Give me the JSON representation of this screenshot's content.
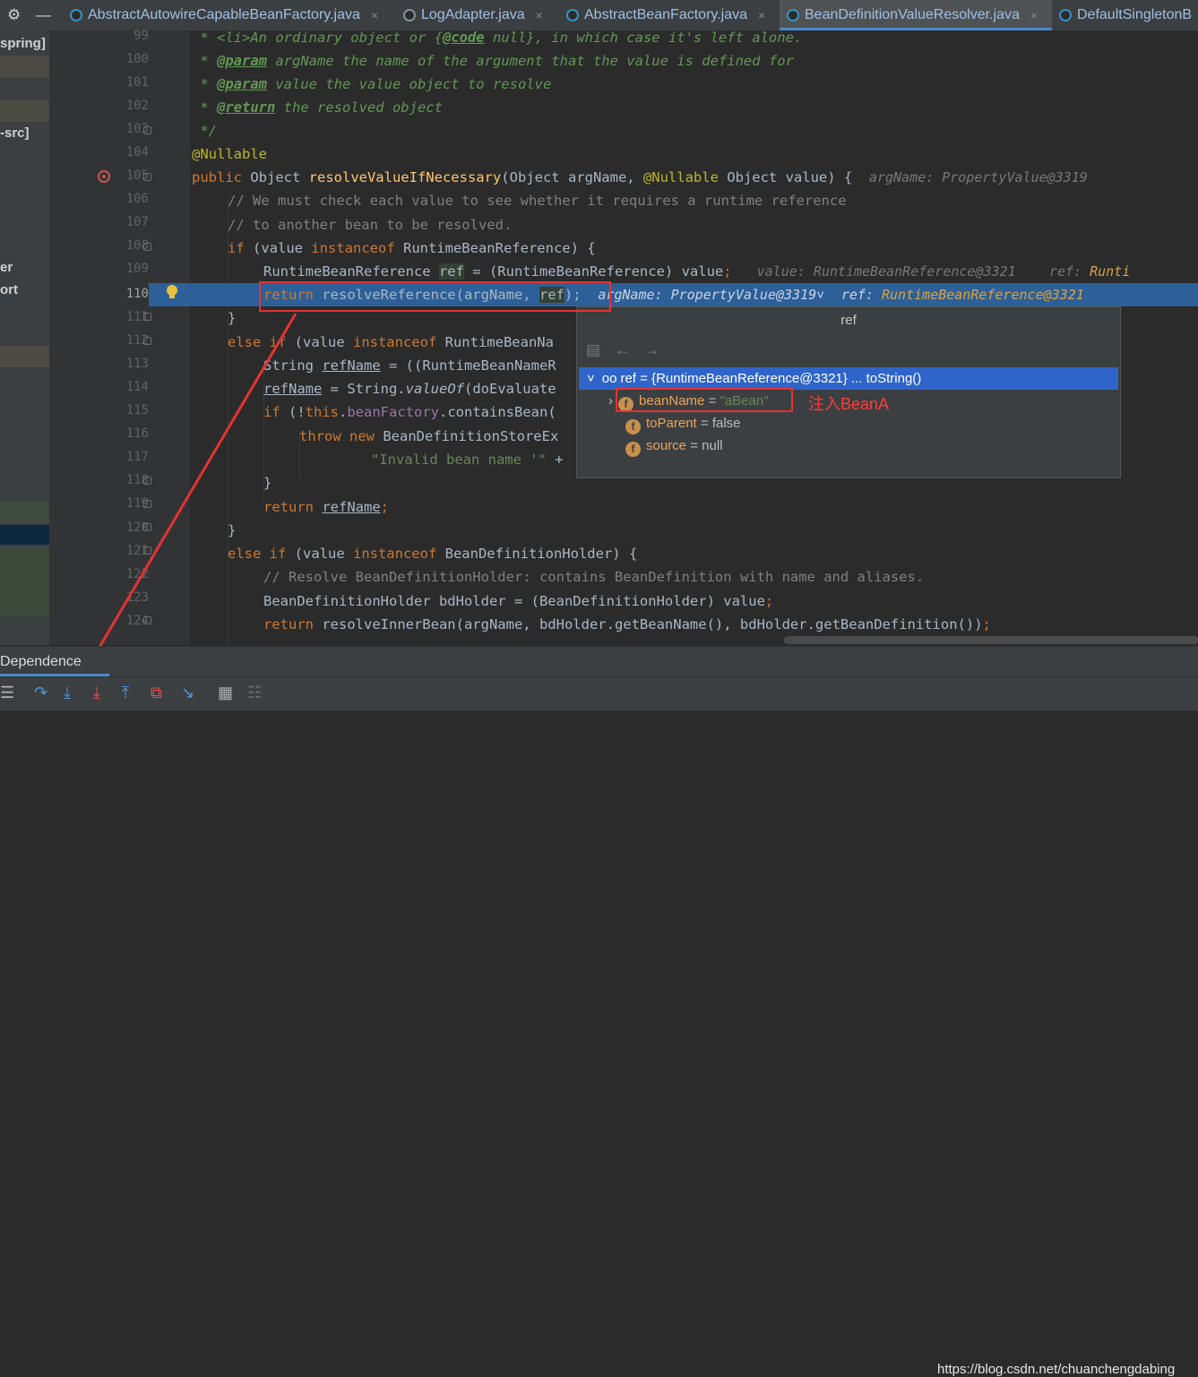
{
  "tabs": [
    {
      "label": "AbstractAutowireCapableBeanFactory.java",
      "close": "×",
      "active": false
    },
    {
      "label": "LogAdapter.java",
      "close": "×",
      "active": false
    },
    {
      "label": "AbstractBeanFactory.java",
      "close": "×",
      "active": false
    },
    {
      "label": "BeanDefinitionValueResolver.java",
      "close": "×",
      "active": true
    },
    {
      "label": "DefaultSingletonB",
      "close": "",
      "active": false
    }
  ],
  "project": {
    "labels": [
      "spring]",
      "-src]",
      "er",
      "ort"
    ]
  },
  "line_numbers": [
    "99",
    "100",
    "101",
    "102",
    "103",
    "104",
    "105",
    "106",
    "107",
    "108",
    "109",
    "110",
    "111",
    "112",
    "113",
    "114",
    "115",
    "116",
    "117",
    "118",
    "119",
    "120",
    "121",
    "122",
    "123",
    "124"
  ],
  "code": {
    "l99_a": " * <li>An ordinary object or {",
    "l99_b": "@code",
    "l99_c": " null}, in which case it's left alone.",
    "l100_a": " * ",
    "l100_tag": "@param",
    "l100_b": " argName the name of the argument that the value is defined for",
    "l101_a": " * ",
    "l101_tag": "@param",
    "l101_b": " value the value object to resolve",
    "l102_a": " * ",
    "l102_tag": "@return",
    "l102_b": " the resolved object",
    "l103": " */",
    "l104": "@Nullable",
    "l105_kw": "public ",
    "l105_a": "Object ",
    "l105_fn": "resolveValueIfNecessary",
    "l105_b": "(Object argName, ",
    "l105_ann": "@Nullable",
    "l105_c": " Object value) {",
    "l105_hint": "argName: PropertyValue@3319",
    "l106": "// We must check each value to see whether it requires a runtime reference",
    "l107": "// to another bean to be resolved.",
    "l108_kw1": "if ",
    "l108_a": "(value ",
    "l108_kw2": "instanceof ",
    "l108_b": "RuntimeBeanReference) {",
    "l109_a": "RuntimeBeanReference ",
    "l109_ref": "ref",
    "l109_b": " = (RuntimeBeanReference) value",
    "l109_semi": ";",
    "l109_hint1": "value: RuntimeBeanReference@3321",
    "l109_hint2": "ref: ",
    "l109_hint3": "Runti",
    "l110_kw": "return ",
    "l110_a": "resolveReference(argName, ",
    "l110_ref": "ref",
    "l110_b": ");",
    "l110_hint1": "argName: PropertyValue@3319",
    "l110_chev": "˅",
    "l110_hint2": "ref: ",
    "l110_hint3": "RuntimeBeanReference@3321",
    "l111": "}",
    "l112_kw1": "else if ",
    "l112_a": "(value ",
    "l112_kw2": "instanceof ",
    "l112_b": "RuntimeBeanNa",
    "l113_a": "String ",
    "l113_ul": "refName",
    "l113_b": " = ((RuntimeBeanNameR",
    "l114_ul": "refName",
    "l114_a": " = String.",
    "l114_it": "valueOf",
    "l114_b": "(doEvaluate",
    "l115_kw": "if ",
    "l115_a": "(!",
    "l115_kw2": "this",
    "l115_b": ".",
    "l115_fld": "beanFactory",
    "l115_c": ".containsBean(",
    "l116_kw": "throw new ",
    "l116_a": "BeanDefinitionStoreEx",
    "l117_str": "\"Invalid bean name '\"",
    "l117_a": " +",
    "l118": "}",
    "l119_kw": "return ",
    "l119_ul": "refName",
    "l119_semi": ";",
    "l120": "}",
    "l121_kw1": "else if ",
    "l121_a": "(value ",
    "l121_kw2": "instanceof ",
    "l121_b": "BeanDefinitionHolder) {",
    "l122": "// Resolve BeanDefinitionHolder: contains BeanDefinition with name and aliases.",
    "l123_a": "BeanDefinitionHolder bdHolder = (BeanDefinitionHolder) value",
    "l123_semi": ";",
    "l124_kw": "return ",
    "l124_a": "resolveInnerBean(argName, bdHolder.getBeanName(), bdHolder.getBeanDefinition())",
    "l124_semi": ";"
  },
  "popup": {
    "title": "ref",
    "root": {
      "chevron": "˅",
      "glasses": "oo",
      "text": "ref = {RuntimeBeanReference@3321} ... toString()"
    },
    "fields": [
      {
        "expander": "›",
        "icon": "f",
        "name": "beanName",
        "eq": " = ",
        "value": "\"aBean\""
      },
      {
        "expander": "",
        "icon": "f",
        "name": "toParent",
        "eq": " = ",
        "value": "false"
      },
      {
        "expander": "",
        "icon": "f",
        "name": "source",
        "eq": " = ",
        "value": "null"
      }
    ]
  },
  "annotation": "注入BeanA",
  "debug_tab": "Dependence",
  "watermark": "https://blog.csdn.net/chuanchengdabing",
  "colors": {
    "accent": "#4a88c7",
    "selection": "#2d6099",
    "annotation_red": "#e53232"
  }
}
